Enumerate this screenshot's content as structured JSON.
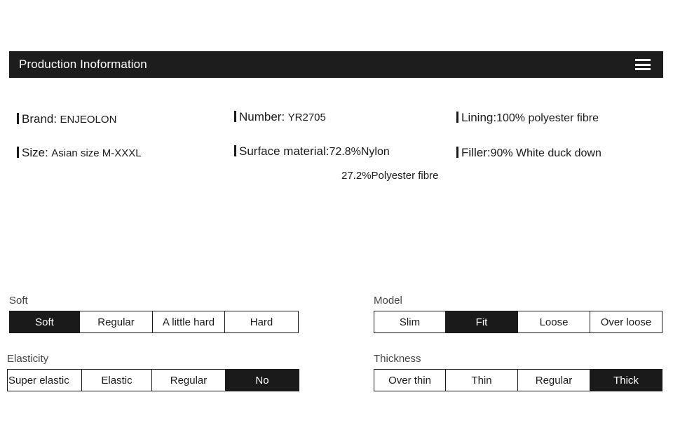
{
  "header": {
    "title": "Production Inoformation",
    "menu_icon": "hamburger-menu-icon"
  },
  "info": {
    "brand": {
      "label": "Brand:",
      "value": "ENJEOLON"
    },
    "size": {
      "label": "Size:",
      "value": "Asian size M-XXXL"
    },
    "number": {
      "label": "Number:",
      "value": "YR2705"
    },
    "surface_material": {
      "label": "Surface material:",
      "value": "72.8%Nylon",
      "value2": "27.2%Polyester fibre"
    },
    "lining": {
      "label": "Lining:",
      "value": "100% polyester fibre"
    },
    "filler": {
      "label": "Filler:",
      "value": "90% White duck down"
    }
  },
  "groups": {
    "soft": {
      "label": "Soft",
      "options": [
        "Soft",
        "Regular",
        "A little hard",
        "Hard"
      ],
      "selected": "Soft"
    },
    "elasticity": {
      "label": "Elasticity",
      "options": [
        "Super elastic",
        "Elastic",
        "Regular",
        "No"
      ],
      "selected": "No"
    },
    "model": {
      "label": "Model",
      "options": [
        "Slim",
        "Fit",
        "Loose",
        "Over loose"
      ],
      "selected": "Fit"
    },
    "thickness": {
      "label": "Thickness",
      "options": [
        "Over thin",
        "Thin",
        "Regular",
        "Thick"
      ],
      "selected": "Thick"
    }
  },
  "colors": {
    "selected_bg": "#1a1a1a",
    "header_bg": "#1d1d1d",
    "text": "#1a1a1a",
    "label_text": "#444444"
  }
}
